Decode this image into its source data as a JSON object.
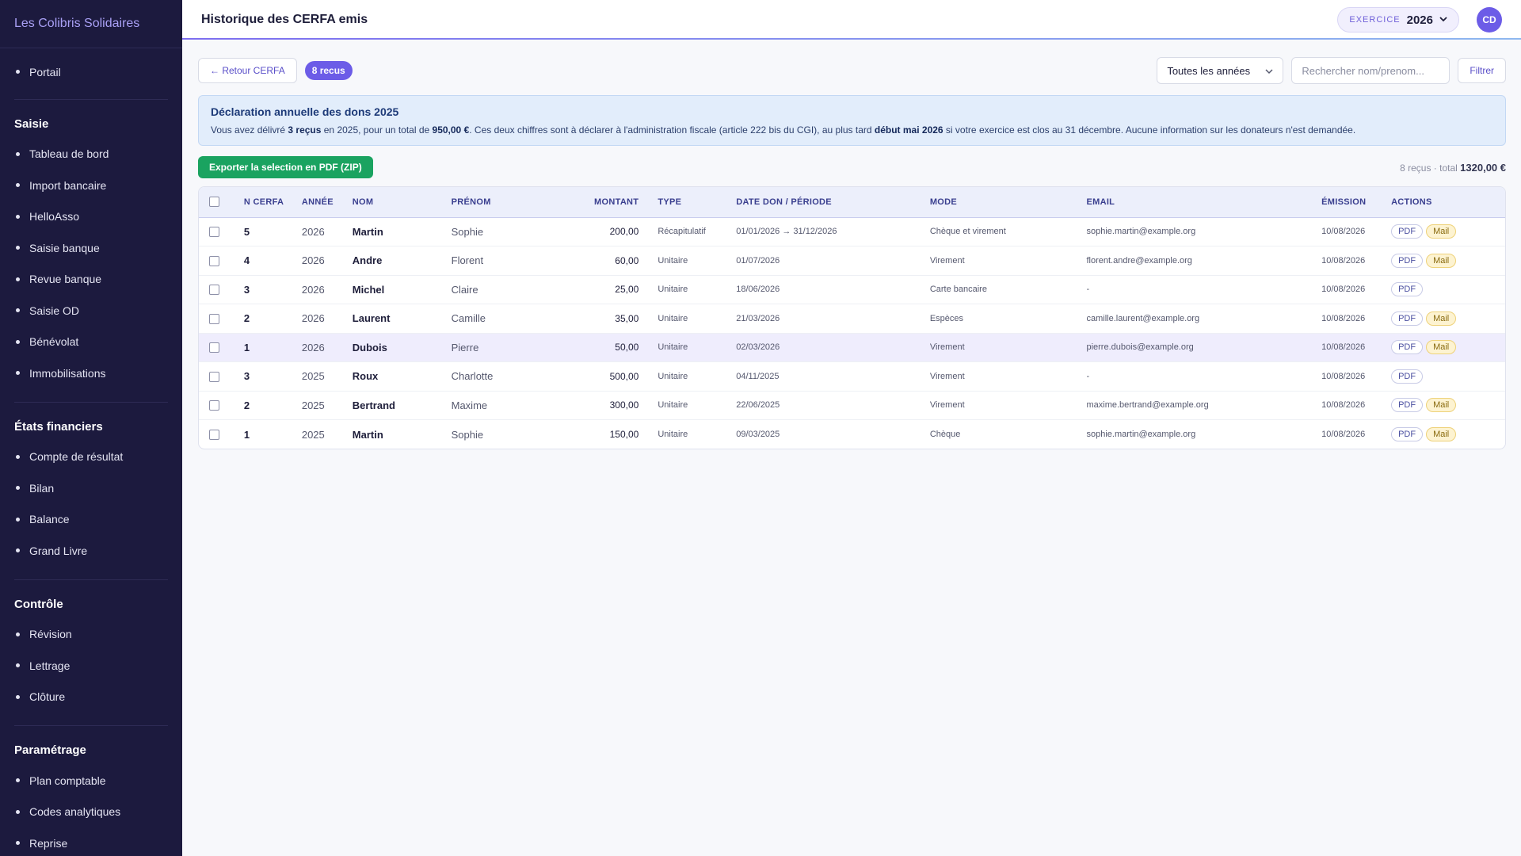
{
  "sidebar": {
    "brand": "Les Colibris Solidaires",
    "portal": "Portail",
    "sections": [
      {
        "title": "Saisie",
        "items": [
          "Tableau de bord",
          "Import bancaire",
          "HelloAsso",
          "Saisie banque",
          "Revue banque",
          "Saisie OD",
          "Bénévolat",
          "Immobilisations"
        ]
      },
      {
        "title": "États financiers",
        "items": [
          "Compte de résultat",
          "Bilan",
          "Balance",
          "Grand Livre"
        ]
      },
      {
        "title": "Contrôle",
        "items": [
          "Révision",
          "Lettrage",
          "Clôture"
        ]
      },
      {
        "title": "Paramétrage",
        "items": [
          "Plan comptable",
          "Codes analytiques",
          "Reprise"
        ]
      }
    ]
  },
  "header": {
    "title": "Historique des CERFA emis",
    "exercice_label": "EXERCICE",
    "exercice_year": "2026",
    "avatar": "CD"
  },
  "toolbar": {
    "back_label": "← Retour CERFA",
    "count_badge": "8 recus",
    "year_filter": "Toutes les années",
    "search_placeholder": "Rechercher nom/prenom...",
    "filter_label": "Filtrer"
  },
  "info": {
    "title": "Déclaration annuelle des dons 2025",
    "text_1": "Vous avez délivré ",
    "count": "3 reçus",
    "text_2": " en 2025, pour un total de ",
    "amount": "950,00 €",
    "text_3": ". Ces deux chiffres sont à déclarer à l'administration fiscale (article 222 bis du CGI), au plus tard ",
    "deadline": "début mai 2026",
    "text_4": " si votre exercice est clos au 31 décembre. Aucune information sur les donateurs n'est demandée."
  },
  "export": {
    "button_label": "Exporter la selection en PDF (ZIP)",
    "summary_prefix": "8 reçus · total ",
    "summary_total": "1320,00 €"
  },
  "table": {
    "columns": [
      "N CERFA",
      "ANNÉE",
      "NOM",
      "PRÉNOM",
      "MONTANT",
      "TYPE",
      "DATE DON / PÉRIODE",
      "MODE",
      "EMAIL",
      "ÉMISSION",
      "ACTIONS"
    ],
    "pdf_label": "PDF",
    "mail_label": "Mail",
    "rows": [
      {
        "num": "5",
        "year": "2026",
        "nom": "Martin",
        "prenom": "Sophie",
        "montant": "200,00",
        "type": "Récapitulatif",
        "date": "01/01/2026 → 31/12/2026",
        "mode": "Chèque et virement",
        "email": "sophie.martin@example.org",
        "emission": "10/08/2026",
        "mail": true
      },
      {
        "num": "4",
        "year": "2026",
        "nom": "Andre",
        "prenom": "Florent",
        "montant": "60,00",
        "type": "Unitaire",
        "date": "01/07/2026",
        "mode": "Virement",
        "email": "florent.andre@example.org",
        "emission": "10/08/2026",
        "mail": true
      },
      {
        "num": "3",
        "year": "2026",
        "nom": "Michel",
        "prenom": "Claire",
        "montant": "25,00",
        "type": "Unitaire",
        "date": "18/06/2026",
        "mode": "Carte bancaire",
        "email": "-",
        "emission": "10/08/2026",
        "mail": false
      },
      {
        "num": "2",
        "year": "2026",
        "nom": "Laurent",
        "prenom": "Camille",
        "montant": "35,00",
        "type": "Unitaire",
        "date": "21/03/2026",
        "mode": "Espèces",
        "email": "camille.laurent@example.org",
        "emission": "10/08/2026",
        "mail": true
      },
      {
        "num": "1",
        "year": "2026",
        "nom": "Dubois",
        "prenom": "Pierre",
        "montant": "50,00",
        "type": "Unitaire",
        "date": "02/03/2026",
        "mode": "Virement",
        "email": "pierre.dubois@example.org",
        "emission": "10/08/2026",
        "mail": true,
        "highlight": true
      },
      {
        "num": "3",
        "year": "2025",
        "nom": "Roux",
        "prenom": "Charlotte",
        "montant": "500,00",
        "type": "Unitaire",
        "date": "04/11/2025",
        "mode": "Virement",
        "email": "-",
        "emission": "10/08/2026",
        "mail": false
      },
      {
        "num": "2",
        "year": "2025",
        "nom": "Bertrand",
        "prenom": "Maxime",
        "montant": "300,00",
        "type": "Unitaire",
        "date": "22/06/2025",
        "mode": "Virement",
        "email": "maxime.bertrand@example.org",
        "emission": "10/08/2026",
        "mail": true
      },
      {
        "num": "1",
        "year": "2025",
        "nom": "Martin",
        "prenom": "Sophie",
        "montant": "150,00",
        "type": "Unitaire",
        "date": "09/03/2025",
        "mode": "Chèque",
        "email": "sophie.martin@example.org",
        "emission": "10/08/2026",
        "mail": true
      }
    ]
  }
}
